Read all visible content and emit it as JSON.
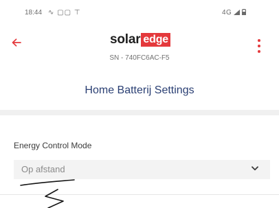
{
  "status_bar": {
    "time": "18:44",
    "notification_icons": "∿ ▢▢ ⊤",
    "network": "4G"
  },
  "app_bar": {
    "logo_text_primary": "solar",
    "logo_text_boxed": "edge",
    "serial": "SN - 740FC6AC-F5",
    "accent_color": "#e4393c"
  },
  "page": {
    "title": "Home Batterij Settings"
  },
  "energy_control": {
    "label": "Energy Control Mode",
    "selected_value": "Op afstand"
  },
  "icons": {
    "back": "arrow-left-icon",
    "menu": "more-vert-icon",
    "dropdown": "chevron-down-icon"
  }
}
